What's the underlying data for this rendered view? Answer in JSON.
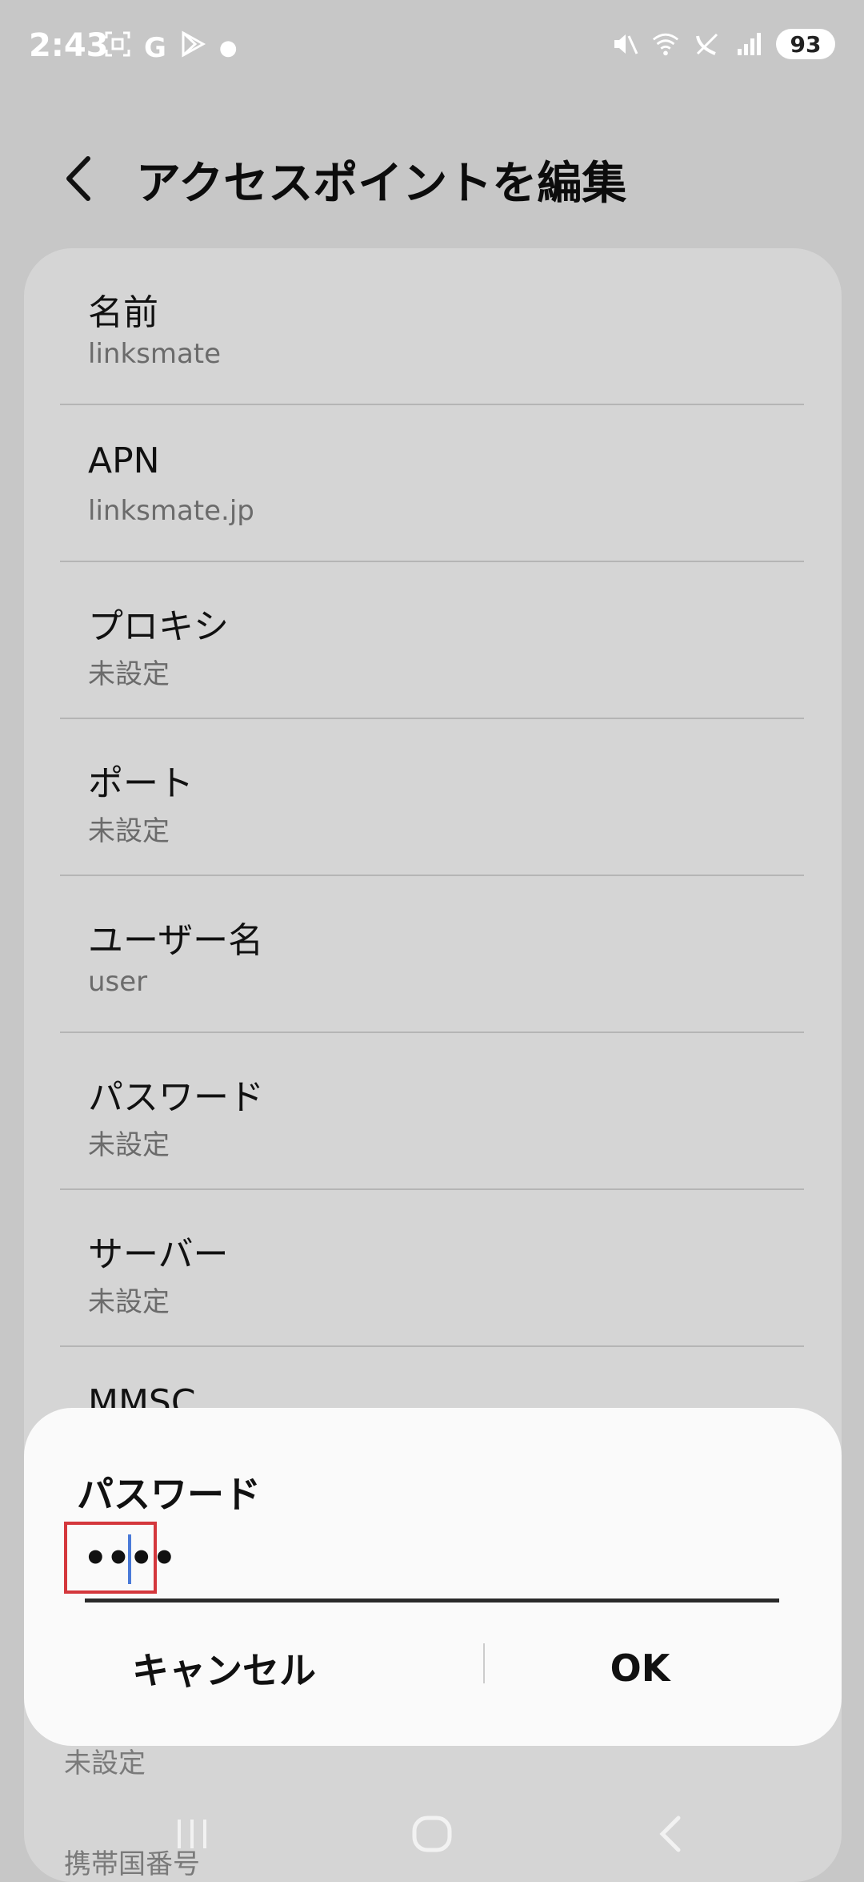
{
  "status": {
    "time": "2:43",
    "battery": "93",
    "left_icons": [
      "screenshot-icon",
      "google-icon",
      "play-store-icon",
      "dot-icon"
    ],
    "right_icons": [
      "mute-icon",
      "wifi-icon",
      "call-off-icon",
      "signal-icon"
    ]
  },
  "header": {
    "title": "アクセスポイントを編集"
  },
  "items": [
    {
      "label": "名前",
      "value": "linksmate"
    },
    {
      "label": "APN",
      "value": "linksmate.jp"
    },
    {
      "label": "プロキシ",
      "value": "未設定"
    },
    {
      "label": "ポート",
      "value": "未設定"
    },
    {
      "label": "ユーザー名",
      "value": "user"
    },
    {
      "label": "パスワード",
      "value": "未設定"
    },
    {
      "label": "サーバー",
      "value": "未設定"
    },
    {
      "label": "MMSC",
      "value": ""
    }
  ],
  "below_dialog": {
    "value": "未設定",
    "partial_label": "携帯国番号"
  },
  "dialog": {
    "title": "パスワード",
    "input_value": "••••",
    "cancel_label": "キャンセル",
    "ok_label": "OK"
  },
  "colors": {
    "highlight": "#d4373c",
    "caret": "#4a7ad8"
  }
}
